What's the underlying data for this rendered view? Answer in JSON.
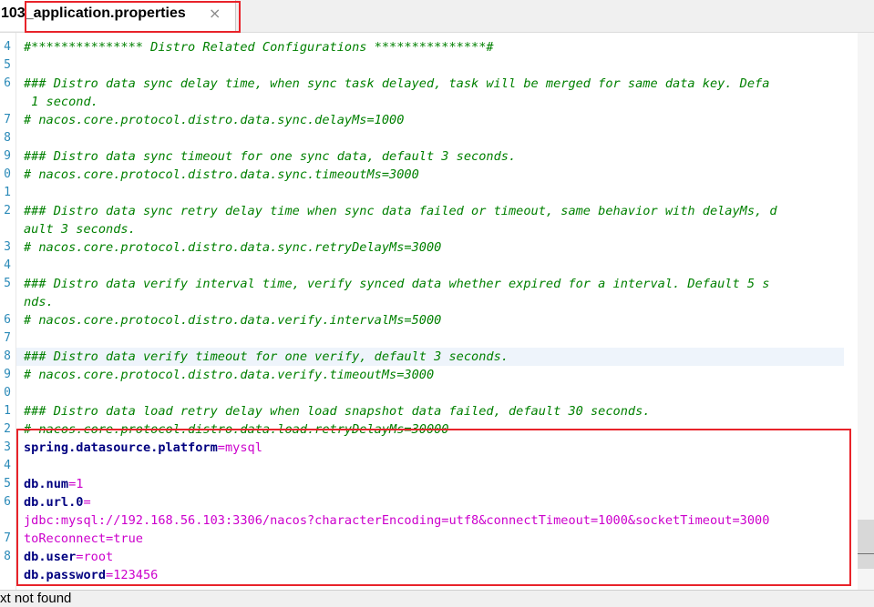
{
  "tab": {
    "title": "103_application.properties",
    "close": "×"
  },
  "gutter": [
    "4",
    "5",
    "6",
    "",
    "7",
    "8",
    "9",
    "0",
    "1",
    "2",
    "",
    "3",
    "4",
    "5",
    "",
    "6",
    "7",
    "8",
    "9",
    "0",
    "1",
    "2",
    "3",
    "4",
    "5",
    "6",
    "",
    "7",
    "8"
  ],
  "rows": [
    [
      [
        "c-comment",
        "#*************** Distro Related Configurations ***************#"
      ]
    ],
    [],
    [
      [
        "c-comment",
        "### Distro data sync delay time, when sync task delayed, task will be merged for same data key. Defa"
      ]
    ],
    [
      [
        "c-comment",
        " 1 second."
      ]
    ],
    [
      [
        "c-comment",
        "# nacos.core.protocol.distro.data.sync.delayMs=1000"
      ]
    ],
    [],
    [
      [
        "c-comment",
        "### Distro data sync timeout for one sync data, default 3 seconds."
      ]
    ],
    [
      [
        "c-comment",
        "# nacos.core.protocol.distro.data.sync.timeoutMs=3000"
      ]
    ],
    [],
    [
      [
        "c-comment",
        "### Distro data sync retry delay time when sync data failed or timeout, same behavior with delayMs, d"
      ]
    ],
    [
      [
        "c-comment",
        "ault 3 seconds."
      ]
    ],
    [
      [
        "c-comment",
        "# nacos.core.protocol.distro.data.sync.retryDelayMs=3000"
      ]
    ],
    [],
    [
      [
        "c-comment",
        "### Distro data verify interval time, verify synced data whether expired for a interval. Default 5 s"
      ]
    ],
    [
      [
        "c-comment",
        "nds."
      ]
    ],
    [
      [
        "c-comment",
        "# nacos.core.protocol.distro.data.verify.intervalMs=5000"
      ]
    ],
    [],
    [
      [
        "c-comment",
        "### Distro data verify timeout for one verify, default 3 seconds."
      ]
    ],
    [
      [
        "c-comment",
        "# nacos.core.protocol.distro.data.verify.timeoutMs=3000"
      ]
    ],
    [],
    [
      [
        "c-comment",
        "### Distro data load retry delay when load snapshot data failed, default 30 seconds."
      ]
    ],
    [
      [
        "c-comment",
        "# nacos.core.protocol.distro.data.load.retryDelayMs=30000"
      ]
    ],
    [
      [
        "c-key",
        "spring.datasource.platform"
      ],
      [
        "c-eq",
        "="
      ],
      [
        "c-val",
        "mysql"
      ]
    ],
    [],
    [
      [
        "c-key",
        "db.num"
      ],
      [
        "c-eq",
        "="
      ],
      [
        "c-val",
        "1"
      ]
    ],
    [
      [
        "c-key",
        "db.url.0"
      ],
      [
        "c-eq",
        "="
      ]
    ],
    [
      [
        "c-val",
        "jdbc:mysql://192.168.56.103:3306/nacos?characterEncoding=utf8&connectTimeout=1000&socketTimeout=3000"
      ]
    ],
    [
      [
        "c-val",
        "toReconnect=true"
      ]
    ],
    [
      [
        "c-key",
        "db.user"
      ],
      [
        "c-eq",
        "="
      ],
      [
        "c-val",
        "root"
      ]
    ],
    [
      [
        "c-key",
        "db.password"
      ],
      [
        "c-eq",
        "="
      ],
      [
        "c-val",
        "123456"
      ]
    ]
  ],
  "active_row": 17,
  "status": {
    "text": "xt not found"
  }
}
